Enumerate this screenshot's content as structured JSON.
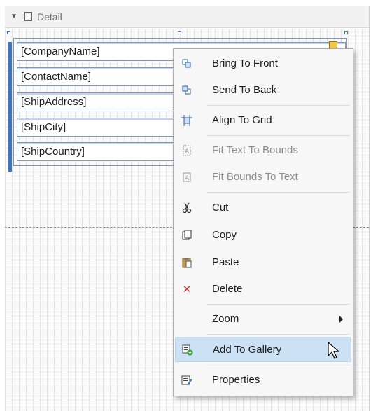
{
  "band": {
    "title": "Detail",
    "toggle_icon": "triangle-down-icon",
    "band_icon": "report-band-icon"
  },
  "fields": [
    "[CompanyName]",
    "[ContactName]",
    "[ShipAddress]",
    "[ShipCity]",
    "[ShipCountry]"
  ],
  "context_menu": {
    "items": [
      {
        "label": "Bring To Front",
        "icon": "bring-to-front-icon",
        "enabled": true
      },
      {
        "label": "Send To Back",
        "icon": "send-to-back-icon",
        "enabled": true
      },
      {
        "label": "Align To Grid",
        "icon": "align-to-grid-icon",
        "enabled": true
      },
      {
        "label": "Fit Text To Bounds",
        "icon": "fit-text-to-bounds-icon",
        "enabled": false
      },
      {
        "label": "Fit Bounds To Text",
        "icon": "fit-bounds-to-text-icon",
        "enabled": false
      },
      {
        "label": "Cut",
        "icon": "scissors-icon",
        "enabled": true
      },
      {
        "label": "Copy",
        "icon": "copy-icon",
        "enabled": true
      },
      {
        "label": "Paste",
        "icon": "paste-icon",
        "enabled": true
      },
      {
        "label": "Delete",
        "icon": "delete-x-icon",
        "enabled": true
      },
      {
        "label": "Zoom",
        "icon": "",
        "enabled": true,
        "submenu": true
      },
      {
        "label": "Add To Gallery",
        "icon": "add-to-gallery-icon",
        "enabled": true,
        "highlighted": true
      },
      {
        "label": "Properties",
        "icon": "properties-icon",
        "enabled": true
      }
    ]
  },
  "colors": {
    "menu_highlight": "#cde1f4",
    "selection_border": "#7f98b5",
    "grip_blue": "#3f74c4",
    "delete_red": "#c0392b"
  }
}
